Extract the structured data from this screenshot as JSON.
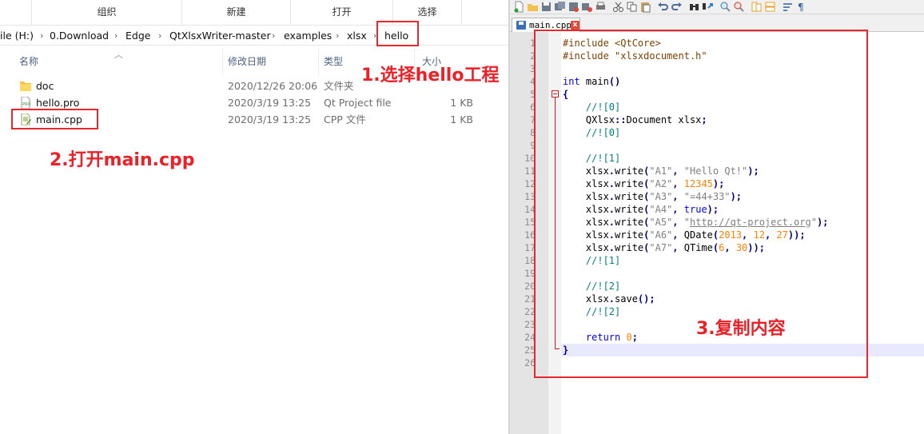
{
  "explorer": {
    "ribbon_groups": [
      "组织",
      "新建",
      "打开",
      "选择"
    ],
    "breadcrumb": [
      "ile (H:)",
      "0.Download",
      "Edge",
      "QtXlsxWriter-master",
      "examples",
      "xlsx",
      "hello"
    ],
    "columns": {
      "name": "名称",
      "date": "修改日期",
      "type": "类型",
      "size": "大小"
    },
    "files": [
      {
        "icon": "folder-icon",
        "name": "doc",
        "date": "2020/12/26 20:06",
        "type": "文件夹",
        "size": ""
      },
      {
        "icon": "qt-project-file-icon",
        "name": "hello.pro",
        "date": "2020/3/19 13:25",
        "type": "Qt Project file",
        "size": "1 KB"
      },
      {
        "icon": "cpp-file-icon",
        "name": "main.cpp",
        "date": "2020/3/19 13:25",
        "type": "CPP 文件",
        "size": "1 KB"
      }
    ]
  },
  "annotations": {
    "step1": "1.选择hello工程",
    "step2": "2.打开main.cpp",
    "step3": "3.复制内容",
    "color": "#ec2027"
  },
  "editor": {
    "tab_label": "main.cpp",
    "tab_close": "x",
    "current_line": 25,
    "lines": [
      [
        [
          "pre",
          "#include <QtCore>"
        ]
      ],
      [
        [
          "pre",
          "#include \"xlsxdocument.h\""
        ]
      ],
      [],
      [
        [
          "kw",
          "int"
        ],
        [
          "txt",
          " main"
        ],
        [
          "op",
          "()"
        ]
      ],
      [
        [
          "op",
          "{"
        ]
      ],
      [
        [
          "txt",
          "    "
        ],
        [
          "cmt",
          "//![0]"
        ]
      ],
      [
        [
          "txt",
          "    QXlsx"
        ],
        [
          "op",
          "::"
        ],
        [
          "txt",
          "Document xlsx"
        ],
        [
          "op",
          ";"
        ]
      ],
      [
        [
          "txt",
          "    "
        ],
        [
          "cmt",
          "//![0]"
        ]
      ],
      [],
      [
        [
          "txt",
          "    "
        ],
        [
          "cmt",
          "//![1]"
        ]
      ],
      [
        [
          "txt",
          "    xlsx"
        ],
        [
          "op",
          "."
        ],
        [
          "txt",
          "write"
        ],
        [
          "op",
          "("
        ],
        [
          "str",
          "\"A1\""
        ],
        [
          "op",
          ","
        ],
        [
          "txt",
          " "
        ],
        [
          "str",
          "\"Hello Qt!\""
        ],
        [
          "op",
          ");"
        ]
      ],
      [
        [
          "txt",
          "    xlsx"
        ],
        [
          "op",
          "."
        ],
        [
          "txt",
          "write"
        ],
        [
          "op",
          "("
        ],
        [
          "str",
          "\"A2\""
        ],
        [
          "op",
          ","
        ],
        [
          "txt",
          " "
        ],
        [
          "num",
          "12345"
        ],
        [
          "op",
          ");"
        ]
      ],
      [
        [
          "txt",
          "    xlsx"
        ],
        [
          "op",
          "."
        ],
        [
          "txt",
          "write"
        ],
        [
          "op",
          "("
        ],
        [
          "str",
          "\"A3\""
        ],
        [
          "op",
          ","
        ],
        [
          "txt",
          " "
        ],
        [
          "str",
          "\"=44+33\""
        ],
        [
          "op",
          ");"
        ]
      ],
      [
        [
          "txt",
          "    xlsx"
        ],
        [
          "op",
          "."
        ],
        [
          "txt",
          "write"
        ],
        [
          "op",
          "("
        ],
        [
          "str",
          "\"A4\""
        ],
        [
          "op",
          ","
        ],
        [
          "txt",
          " "
        ],
        [
          "kw",
          "true"
        ],
        [
          "op",
          ");"
        ]
      ],
      [
        [
          "txt",
          "    xlsx"
        ],
        [
          "op",
          "."
        ],
        [
          "txt",
          "write"
        ],
        [
          "op",
          "("
        ],
        [
          "str",
          "\"A5\""
        ],
        [
          "op",
          ","
        ],
        [
          "txt",
          " "
        ],
        [
          "str",
          "\""
        ],
        [
          "url",
          "http://qt-project.org"
        ],
        [
          "str",
          "\""
        ],
        [
          "op",
          ");"
        ]
      ],
      [
        [
          "txt",
          "    xlsx"
        ],
        [
          "op",
          "."
        ],
        [
          "txt",
          "write"
        ],
        [
          "op",
          "("
        ],
        [
          "str",
          "\"A6\""
        ],
        [
          "op",
          ","
        ],
        [
          "txt",
          " QDate"
        ],
        [
          "op",
          "("
        ],
        [
          "num",
          "2013"
        ],
        [
          "op",
          ","
        ],
        [
          "txt",
          " "
        ],
        [
          "num",
          "12"
        ],
        [
          "op",
          ","
        ],
        [
          "txt",
          " "
        ],
        [
          "num",
          "27"
        ],
        [
          "op",
          "));"
        ]
      ],
      [
        [
          "txt",
          "    xlsx"
        ],
        [
          "op",
          "."
        ],
        [
          "txt",
          "write"
        ],
        [
          "op",
          "("
        ],
        [
          "str",
          "\"A7\""
        ],
        [
          "op",
          ","
        ],
        [
          "txt",
          " QTime"
        ],
        [
          "op",
          "("
        ],
        [
          "num",
          "6"
        ],
        [
          "op",
          ","
        ],
        [
          "txt",
          " "
        ],
        [
          "num",
          "30"
        ],
        [
          "op",
          "));"
        ]
      ],
      [
        [
          "txt",
          "    "
        ],
        [
          "cmt",
          "//![1]"
        ]
      ],
      [],
      [
        [
          "txt",
          "    "
        ],
        [
          "cmt",
          "//![2]"
        ]
      ],
      [
        [
          "txt",
          "    xlsx"
        ],
        [
          "op",
          "."
        ],
        [
          "txt",
          "save"
        ],
        [
          "op",
          "();"
        ]
      ],
      [
        [
          "txt",
          "    "
        ],
        [
          "cmt",
          "//![2]"
        ]
      ],
      [],
      [
        [
          "txt",
          "    "
        ],
        [
          "kw",
          "return"
        ],
        [
          "txt",
          " "
        ],
        [
          "num",
          "0"
        ],
        [
          "op",
          ";"
        ]
      ],
      [
        [
          "op",
          "}"
        ]
      ],
      []
    ]
  }
}
